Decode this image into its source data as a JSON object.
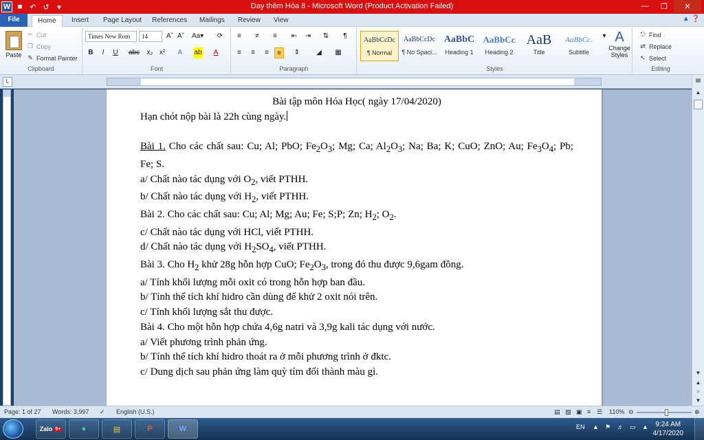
{
  "window": {
    "title": "Day thêm Hóa 8  -  Microsoft Word (Product Activation Failed)",
    "app_icon": "W"
  },
  "tabs": [
    "File",
    "Home",
    "Insert",
    "Page Layout",
    "References",
    "Mailings",
    "Review",
    "View"
  ],
  "ribbon": {
    "clipboard": {
      "paste": "Paste",
      "cut": "Cut",
      "copy": "Copy",
      "format_painter": "Format Painter",
      "label": "Clipboard"
    },
    "font": {
      "name": "Times New Rom",
      "size": "14",
      "label": "Font"
    },
    "paragraph": {
      "label": "Paragraph"
    },
    "styles": {
      "items": [
        {
          "sample": "AaBbCcDc",
          "name": "¶ Normal"
        },
        {
          "sample": "AaBbCcDc",
          "name": "¶ No Spaci..."
        },
        {
          "sample": "AaBbC",
          "name": "Heading 1"
        },
        {
          "sample": "AaBbCc",
          "name": "Heading 2"
        },
        {
          "sample": "AaB",
          "name": "Title"
        },
        {
          "sample": "AaBbCc.",
          "name": "Subtitle"
        }
      ],
      "change_styles": "Change Styles",
      "label": "Styles"
    },
    "editing": {
      "find": "Find",
      "replace": "Replace",
      "select": "Select",
      "label": "Editing"
    }
  },
  "document": {
    "title": "Bài tập môn Hóa Học( ngày 17/04/2020)",
    "deadline": "Hạn chót nộp bài là 22h cùng ngày.",
    "q1_head": "Bài 1.",
    "q1_text_a": " Cho các chất sau: Cu; Al; PbO; Fe",
    "q1_text_b": "O",
    "q1_text_c": "; Mg; Ca; Al",
    "q1_text_d": "O",
    "q1_text_e": "; Na; Ba; K; CuO; ZnO; Au; Fe",
    "q1_text_f": "O",
    "q1_text_g": "; Pb; Fe; S.",
    "sub2": "2",
    "sub3": "3",
    "sub4": "4",
    "q1a_a": "a/ Chất nào tác dụng với O",
    "q1a_b": ", viết PTHH.",
    "q1b_a": "b/ Chất nào tác dụng với H",
    "q1b_b": ", viết PTHH.",
    "q2": "Bài 2. Cho các chất sau: Cu; Al; Mg; Au; Fe; S;P; Zn; H",
    "q2_tail_a": "; O",
    "q2_tail_b": ".",
    "q2c": "c/ Chất nào tác dụng với HCl, viết PTHH.",
    "q2d_a": "d/ Chất nào tác dụng với H",
    "q2d_b": "SO",
    "q2d_c": ", viết PTHH.",
    "q3_a": "Bài 3. Cho H",
    "q3_b": " khử 28g hỗn hợp CuO; Fe",
    "q3_c": "O",
    "q3_d": ", trong đó thu được 9,6gam đồng.",
    "q3a": "a/ Tính khối lượng mỗi oxit có trong hỗn hợp ban đầu.",
    "q3b": "b/ Tính thể tích khí hidro cần dùng để khử 2 oxit nói trên.",
    "q3c": "c/ Tính khối lượng sắt thu được.",
    "q4": "Bài 4. Cho  một hỗn hợp chứa 4,6g natri và 3,9g kali tác dụng với nước.",
    "q4a": "a/ Viết phương trình phản ứng.",
    "q4b": "b/ Tính thể tích khí hidro thoát ra ở mỗi phương trình ở đktc.",
    "q4c": "c/ Dung dịch sau phản ứng làm quỳ tím đổi thành màu gì."
  },
  "statusbar": {
    "page": "Page: 1 of 27",
    "words": "Words: 3,997",
    "language": "English (U.S.)",
    "zoom": "110%",
    "zoom_level": 0.55
  },
  "taskbar": {
    "lang": "EN",
    "time": "9:24 AM",
    "date": "4/17/2020",
    "zalo": "Zalo",
    "zalo_badge": "5+"
  },
  "colors": {
    "titlebar": "#d70f0f",
    "file_tab": "#2a62b8"
  }
}
